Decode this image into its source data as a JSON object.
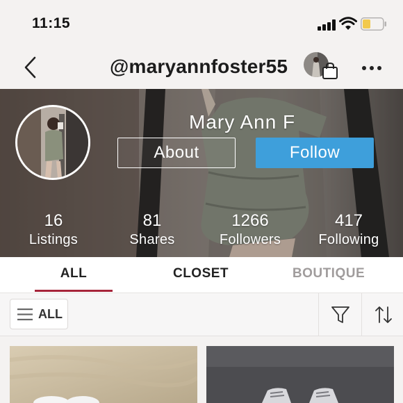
{
  "status_bar": {
    "time": "11:15",
    "icons": [
      "signal-icon",
      "wifi-icon",
      "battery-icon"
    ],
    "battery_color": "#f2c94c"
  },
  "nav": {
    "back_icon": "chevron-left-icon",
    "username": "@maryannfoster55",
    "bag_icon": "shopping-bag-icon",
    "more_icon": "more-horizontal-icon"
  },
  "profile": {
    "display_name": "Mary Ann F",
    "about_label": "About",
    "follow_label": "Follow",
    "stats": [
      {
        "value": "16",
        "label": "Listings"
      },
      {
        "value": "81",
        "label": "Shares"
      },
      {
        "value": "1266",
        "label": "Followers"
      },
      {
        "value": "417",
        "label": "Following"
      }
    ]
  },
  "tabs": [
    {
      "label": "ALL",
      "active": true
    },
    {
      "label": "CLOSET",
      "active": false
    },
    {
      "label": "BOUTIQUE",
      "active": false
    }
  ],
  "filter": {
    "all_label": "ALL",
    "menu_icon": "menu-icon",
    "filter_icon": "funnel-icon",
    "sort_icon": "sort-arrows-icon"
  },
  "colors": {
    "accent": "#a6243a",
    "follow_blue": "#3e9fdb",
    "inactive_tab": "#a09c9c"
  }
}
